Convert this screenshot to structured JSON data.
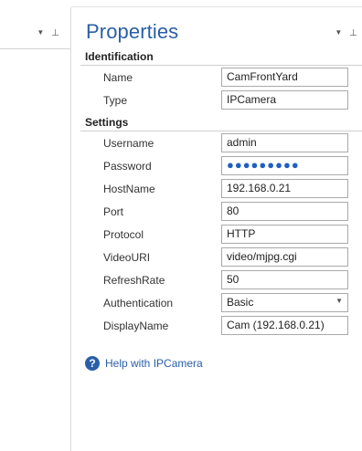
{
  "panel": {
    "title": "Properties",
    "dropdown_icon": "▼",
    "pin_icon": "⊣"
  },
  "sections": [
    {
      "title": "Identification",
      "rows": [
        {
          "label": "Name",
          "value": "CamFrontYard"
        },
        {
          "label": "Type",
          "value": "IPCamera"
        }
      ]
    },
    {
      "title": "Settings",
      "rows": [
        {
          "label": "Username",
          "value": "admin"
        },
        {
          "label": "Password",
          "value": "●●●●●●●●●"
        },
        {
          "label": "HostName",
          "value": "192.168.0.21"
        },
        {
          "label": "Port",
          "value": "80"
        },
        {
          "label": "Protocol",
          "value": "HTTP"
        },
        {
          "label": "VideoURI",
          "value": "video/mjpg.cgi"
        },
        {
          "label": "RefreshRate",
          "value": "50"
        },
        {
          "label": "Authentication",
          "value": "Basic",
          "arrow": "▼"
        },
        {
          "label": "DisplayName",
          "value": "Cam (192.168.0.21)"
        }
      ]
    }
  ],
  "help": {
    "icon": "?",
    "link": "Help with IPCamera"
  },
  "colors": {
    "accent": "#2a5ea8",
    "password_dots": "#1f5fc4"
  }
}
